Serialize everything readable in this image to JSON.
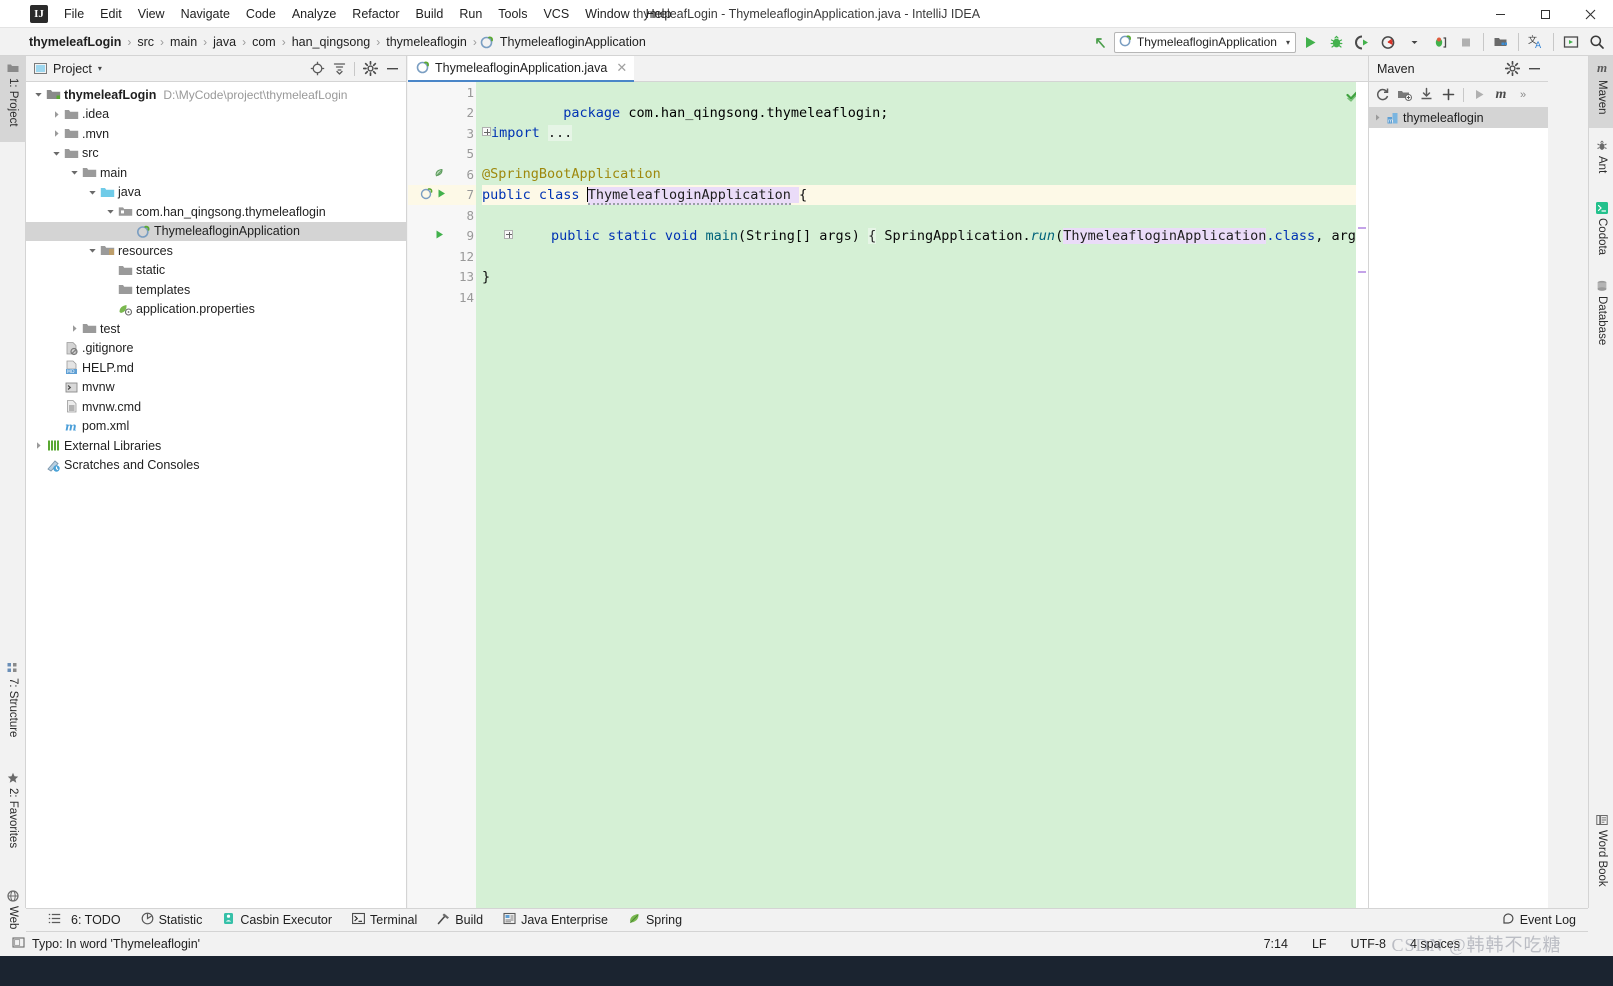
{
  "window": {
    "title": "thymeleafLogin - ThymeleafloginApplication.java - IntelliJ IDEA",
    "minimize": "–",
    "maximize": "❑",
    "close": "✕"
  },
  "menu": {
    "logo_text": "IJ",
    "items": [
      "File",
      "Edit",
      "View",
      "Navigate",
      "Code",
      "Analyze",
      "Refactor",
      "Build",
      "Run",
      "Tools",
      "VCS",
      "Window",
      "Help"
    ]
  },
  "breadcrumb": {
    "items": [
      "thymeleafLogin",
      "src",
      "main",
      "java",
      "com",
      "han_qingsong",
      "thymeleaflogin",
      "ThymeleafloginApplication"
    ],
    "separator": "›"
  },
  "toolbar": {
    "run_config": "ThymeleafloginApplication",
    "run_config_caret": "▾",
    "icons": [
      "back-arrow-icon",
      "run-icon",
      "debug-icon",
      "run-coverage-icon",
      "profiler-icon",
      "attach-debugger-icon",
      "stop-icon",
      "project-structure-icon",
      "translate-icon",
      "presentation-icon",
      "search-everywhere-icon"
    ]
  },
  "left_strip": {
    "tabs": [
      {
        "label": "1: Project",
        "active": true
      },
      {
        "label": "7: Structure",
        "active": false
      },
      {
        "label": "2: Favorites",
        "active": false
      },
      {
        "label": "Web",
        "active": false
      }
    ]
  },
  "project_panel": {
    "title": "Project",
    "caret": "▾",
    "actions": [
      "locate-icon",
      "collapse-all-icon",
      "settings-gear-icon",
      "hide-icon"
    ],
    "tree": [
      {
        "depth": 0,
        "arrow": "down",
        "icon": "module-icon",
        "label": "thymeleafLogin",
        "bold": true,
        "path": "D:\\MyCode\\project\\thymeleafLogin",
        "selected": false
      },
      {
        "depth": 1,
        "arrow": "right",
        "icon": "folder-icon",
        "label": ".idea",
        "selected": false
      },
      {
        "depth": 1,
        "arrow": "right",
        "icon": "folder-icon",
        "label": ".mvn",
        "selected": false
      },
      {
        "depth": 1,
        "arrow": "down",
        "icon": "folder-icon",
        "label": "src",
        "selected": false
      },
      {
        "depth": 2,
        "arrow": "down",
        "icon": "folder-icon",
        "label": "main",
        "selected": false
      },
      {
        "depth": 3,
        "arrow": "down",
        "icon": "source-folder-icon",
        "label": "java",
        "selected": false
      },
      {
        "depth": 4,
        "arrow": "down",
        "icon": "package-icon",
        "label": "com.han_qingsong.thymeleaflogin",
        "selected": false
      },
      {
        "depth": 5,
        "arrow": "none",
        "icon": "spring-class-icon",
        "label": "ThymeleafloginApplication",
        "selected": true
      },
      {
        "depth": 3,
        "arrow": "down",
        "icon": "resource-folder-icon",
        "label": "resources",
        "selected": false
      },
      {
        "depth": 4,
        "arrow": "none",
        "icon": "folder-icon",
        "label": "static",
        "selected": false
      },
      {
        "depth": 4,
        "arrow": "none",
        "icon": "folder-icon",
        "label": "templates",
        "selected": false
      },
      {
        "depth": 4,
        "arrow": "none",
        "icon": "properties-icon",
        "label": "application.properties",
        "selected": false
      },
      {
        "depth": 2,
        "arrow": "right",
        "icon": "folder-icon",
        "label": "test",
        "selected": false
      },
      {
        "depth": 1,
        "arrow": "none",
        "icon": "gitignore-icon",
        "label": ".gitignore",
        "selected": false
      },
      {
        "depth": 1,
        "arrow": "none",
        "icon": "markdown-icon",
        "label": "HELP.md",
        "selected": false
      },
      {
        "depth": 1,
        "arrow": "none",
        "icon": "script-icon",
        "label": "mvnw",
        "selected": false
      },
      {
        "depth": 1,
        "arrow": "none",
        "icon": "file-icon",
        "label": "mvnw.cmd",
        "selected": false
      },
      {
        "depth": 1,
        "arrow": "none",
        "icon": "maven-file-icon",
        "label": "pom.xml",
        "selected": false
      },
      {
        "depth": 0,
        "arrow": "right",
        "icon": "libraries-icon",
        "label": "External Libraries",
        "selected": false
      },
      {
        "depth": 0,
        "arrow": "none",
        "icon": "scratches-icon",
        "label": "Scratches and Consoles",
        "selected": false
      }
    ]
  },
  "editor": {
    "tab": {
      "label": "ThymeleafloginApplication.java",
      "icon": "spring-class-icon",
      "close": "✕"
    },
    "gutter_numbers": [
      "1",
      "2",
      "3",
      "5",
      "6",
      "7",
      "8",
      "9",
      "12",
      "13",
      "14"
    ],
    "current_line_index": 5,
    "lines": [
      {
        "n": "1",
        "type": "package"
      },
      {
        "n": "2",
        "type": "blank"
      },
      {
        "n": "3",
        "type": "import"
      },
      {
        "n": "5",
        "type": "blank"
      },
      {
        "n": "6",
        "type": "annotation"
      },
      {
        "n": "7",
        "type": "class"
      },
      {
        "n": "8",
        "type": "blank"
      },
      {
        "n": "9",
        "type": "main"
      },
      {
        "n": "12",
        "type": "blank"
      },
      {
        "n": "13",
        "type": "closebrace"
      },
      {
        "n": "14",
        "type": "blank"
      }
    ],
    "code": {
      "package_kw": "package",
      "package_name": " com.han_qingsong.thymeleaflogin;",
      "import_kw": "import",
      "import_folded": "...",
      "annotation": "@SpringBootApplication",
      "class_public": "public",
      "class_kw": "class",
      "class_name": "ThymeleafloginApplication",
      "class_brace": "{",
      "main_public": "public",
      "main_static": "static",
      "main_void": "void",
      "main_name": "main",
      "main_args": "(String[] args)",
      "main_openbrace": "{",
      "main_springapp": "SpringApplication.",
      "main_run": "run",
      "main_runopen": "(",
      "main_classref": "ThymeleafloginApplication",
      "main_dotclass": ".class",
      "main_rest": ", args);",
      "main_closebrace": "}",
      "close_brace": "}"
    }
  },
  "maven_panel": {
    "title": "Maven",
    "actions": [
      "settings-gear-icon",
      "hide-icon"
    ],
    "toolbar_icons": [
      "reload-icon",
      "add-module-icon",
      "download-sources-icon",
      "add-icon",
      "run-maven-build-icon",
      "maven-goal-icon",
      "more-icon"
    ],
    "tree": [
      {
        "arrow": "right",
        "icon": "maven-project-icon",
        "label": "thymeleaflogin"
      }
    ]
  },
  "right_strip": {
    "tabs": [
      {
        "label": "Maven",
        "active": true,
        "icon": "maven-icon"
      },
      {
        "label": "Ant",
        "active": false,
        "icon": "ant-icon"
      },
      {
        "label": "Codota",
        "active": false,
        "icon": "codota-icon"
      },
      {
        "label": "Database",
        "active": false,
        "icon": "database-icon"
      },
      {
        "label": "Word Book",
        "active": false,
        "icon": "wordbook-icon"
      }
    ]
  },
  "tool_window_bar": {
    "items": [
      {
        "label": "6: TODO",
        "icon": "todo-icon"
      },
      {
        "label": "Statistic",
        "icon": "statistic-icon"
      },
      {
        "label": "Casbin Executor",
        "icon": "casbin-icon"
      },
      {
        "label": "Terminal",
        "icon": "terminal-icon"
      },
      {
        "label": "Build",
        "icon": "build-hammer-icon"
      },
      {
        "label": "Java Enterprise",
        "icon": "java-enterprise-icon"
      },
      {
        "label": "Spring",
        "icon": "spring-leaf-icon"
      }
    ],
    "event_log": {
      "label": "Event Log",
      "icon": "event-log-icon"
    }
  },
  "status_bar": {
    "message": "Typo: In word 'Thymeleaflogin'",
    "message_icon": "inspection-icon",
    "caret_position": "7:14",
    "line_separator": "LF",
    "encoding": "UTF-8",
    "indent": "4 spaces"
  },
  "watermark": {
    "text": "CSDN @韩韩不吃糖"
  }
}
